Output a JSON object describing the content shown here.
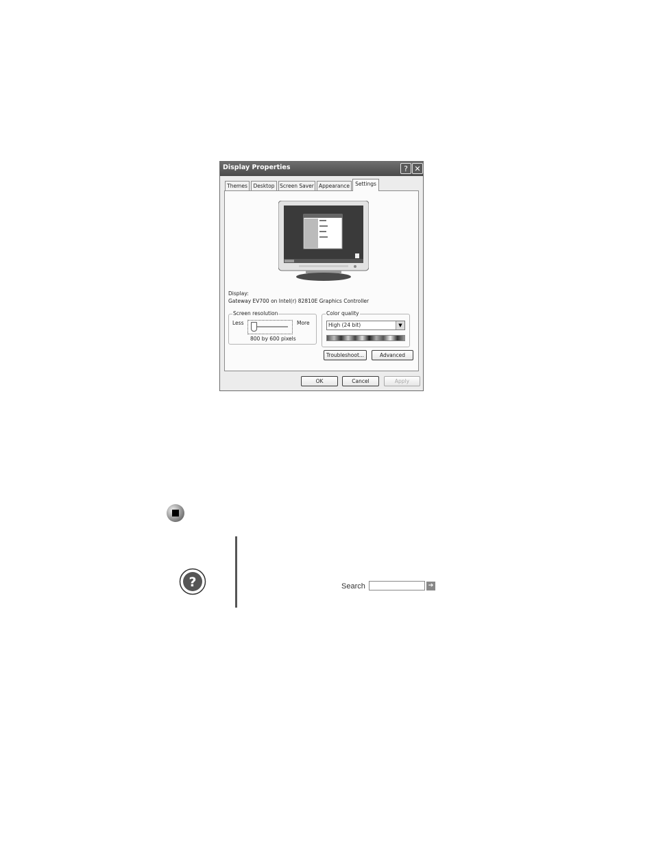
{
  "dialog": {
    "title": "Display Properties",
    "help_btn": "?",
    "close_btn": "✕",
    "tabs": [
      "Themes",
      "Desktop",
      "Screen Saver",
      "Appearance",
      "Settings"
    ],
    "active_tab": "Settings",
    "display_label": "Display:",
    "display_value": "Gateway EV700 on Intel(r) 82810E Graphics Controller",
    "resolution": {
      "legend": "Screen resolution",
      "less": "Less",
      "more": "More",
      "value_text": "800 by 600 pixels",
      "slider_level": 0.0
    },
    "color_quality": {
      "legend": "Color quality",
      "selected": "High (24 bit)"
    },
    "buttons": {
      "troubleshoot": "Troubleshoot...",
      "advanced": "Advanced",
      "ok": "OK",
      "cancel": "Cancel",
      "apply": "Apply"
    }
  },
  "search": {
    "label": "Search",
    "value": ""
  },
  "colors": {
    "titlebar": "#5a5a5a",
    "dialog_bg": "#ececec"
  }
}
